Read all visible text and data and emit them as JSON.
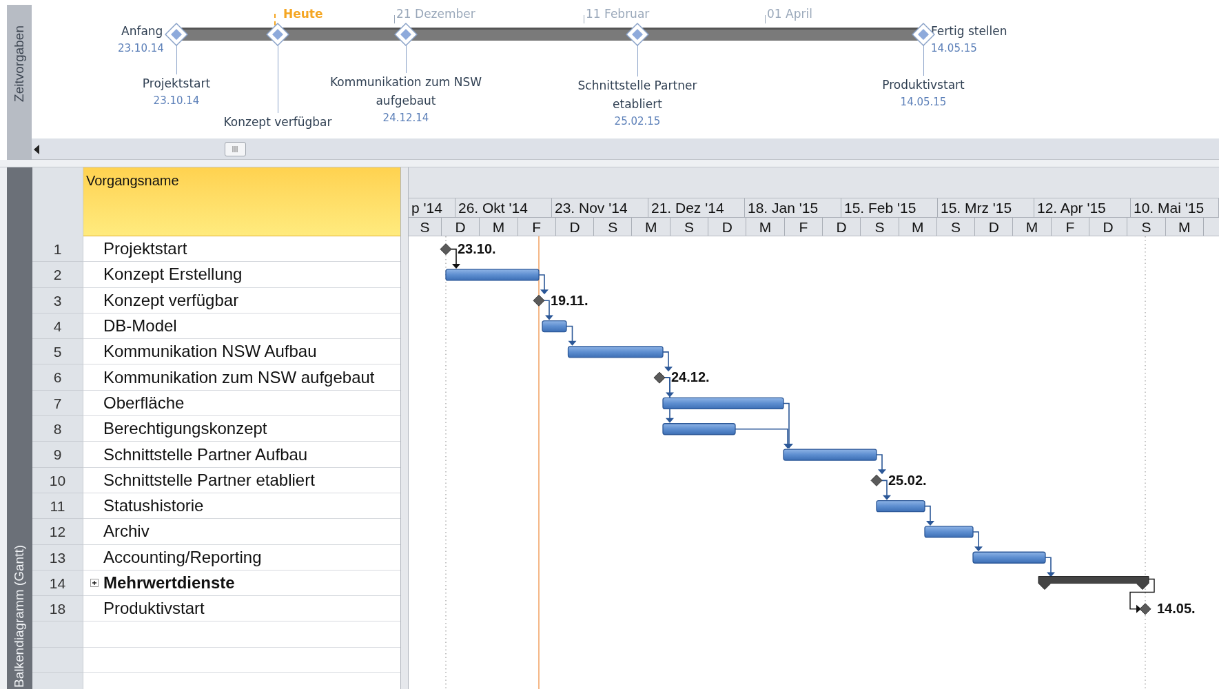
{
  "timeline": {
    "tab_label": "Zeitvorgaben",
    "today_label": "Heute",
    "ticks": [
      "21 Dezember",
      "11 Februar",
      "01 April"
    ],
    "start": {
      "label": "Anfang",
      "date": "23.10.14"
    },
    "finish": {
      "label": "Fertig stellen",
      "date": "14.05.15"
    },
    "milestones": [
      {
        "name": "Projektstart",
        "date": "23.10.14"
      },
      {
        "name": "Konzept verfügbar"
      },
      {
        "name": "Kommunikation zum NSW aufgebaut",
        "date": "24.12.14"
      },
      {
        "name": "Schnittstelle Partner etabliert",
        "date": "25.02.15"
      },
      {
        "name": "Produktivstart",
        "date": "14.05.15"
      }
    ]
  },
  "gantt": {
    "tab_label": "Balkendiagramm (Gantt)",
    "column": "Vorgangsname",
    "timescale_top": [
      "p '14",
      "26. Okt '14",
      "23. Nov '14",
      "21. Dez '14",
      "18. Jan '15",
      "15. Feb '15",
      "15. Mrz '15",
      "12. Apr '15",
      "10. Mai '15"
    ],
    "timescale_bottom": [
      "S",
      "D",
      "M",
      "F",
      "D",
      "S",
      "M",
      "S",
      "D",
      "M",
      "F",
      "D",
      "S",
      "M",
      "S",
      "D",
      "M",
      "F",
      "D",
      "S",
      "M"
    ],
    "rows": [
      {
        "number": "1",
        "name": "Projektstart",
        "kind": "milestone",
        "date_label": "23.10."
      },
      {
        "number": "2",
        "name": "Konzept Erstellung",
        "kind": "task"
      },
      {
        "number": "3",
        "name": "Konzept verfügbar",
        "kind": "milestone",
        "date_label": "19.11."
      },
      {
        "number": "4",
        "name": "DB-Model",
        "kind": "task"
      },
      {
        "number": "5",
        "name": "Kommunikation NSW Aufbau",
        "kind": "task"
      },
      {
        "number": "6",
        "name": "Kommunikation zum NSW aufgebaut",
        "kind": "milestone",
        "date_label": "24.12."
      },
      {
        "number": "7",
        "name": "Oberfläche",
        "kind": "task"
      },
      {
        "number": "8",
        "name": "Berechtigungskonzept",
        "kind": "task"
      },
      {
        "number": "9",
        "name": "Schnittstelle Partner Aufbau",
        "kind": "task"
      },
      {
        "number": "10",
        "name": "Schnittstelle Partner etabliert",
        "kind": "milestone",
        "date_label": "25.02."
      },
      {
        "number": "11",
        "name": "Statushistorie",
        "kind": "task"
      },
      {
        "number": "12",
        "name": "Archiv",
        "kind": "task"
      },
      {
        "number": "13",
        "name": "Accounting/Reporting",
        "kind": "task"
      },
      {
        "number": "14",
        "name": "Mehrwertdienste",
        "kind": "summary",
        "expanded": false
      },
      {
        "number": "18",
        "name": "Produktivstart",
        "kind": "milestone",
        "date_label": "14.05."
      }
    ]
  }
}
